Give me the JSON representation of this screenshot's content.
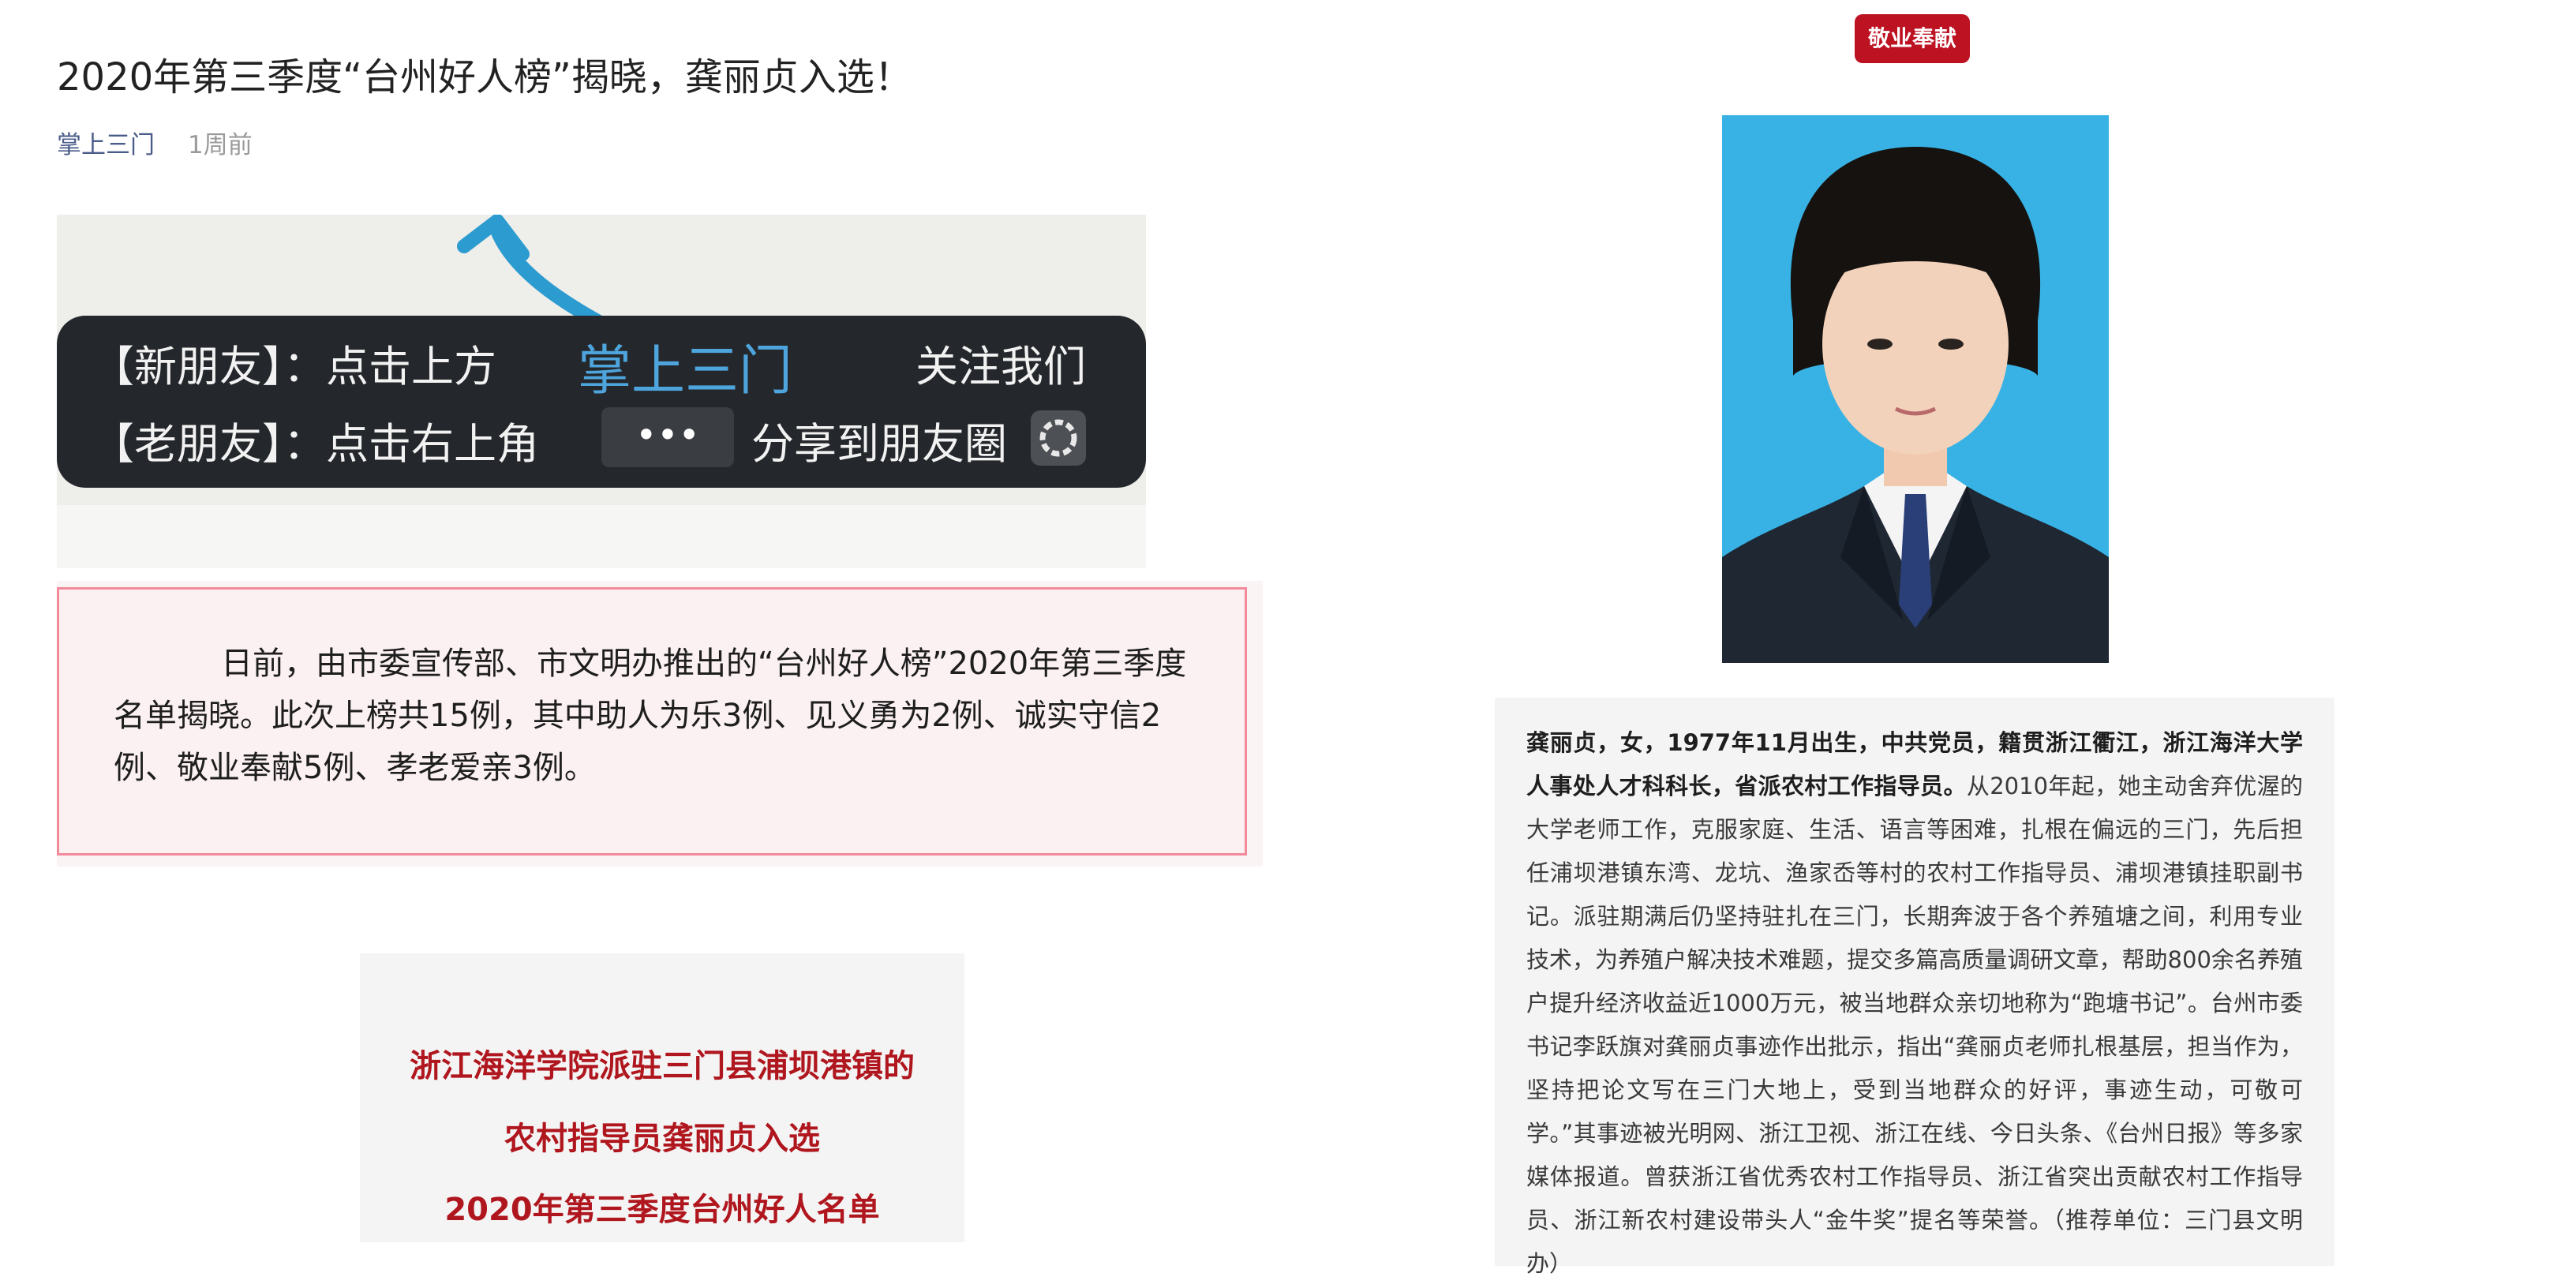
{
  "article": {
    "title": "2020年第三季度“台州好人榜”揭晓，龚丽贞入选！",
    "source": "掌上三门",
    "age": "1周前"
  },
  "banner": {
    "new_friend": "【新朋友】：点击上方",
    "account": "掌上三门",
    "follow": "关注我们",
    "old_friend": "【老朋友】：点击右上角",
    "more_glyph": "•••",
    "share": "分享到朋友圈"
  },
  "intro": "日前，由市委宣传部、市文明办推出的“台州好人榜”2020年第三季度名单揭晓。此次上榜共15例，其中助人为乐3例、见义勇为2例、诚实守信2例、敬业奉献5例、孝老爱亲3例。",
  "card": {
    "line1": "浙江海洋学院派驻三门县浦坝港镇的",
    "line2": "农村指导员龚丽贞入选",
    "line3": "2020年第三季度台州好人名单"
  },
  "category_tag": "敬业奉献",
  "bio": {
    "lead": "龚丽贞，女，1977年11月出生，中共党员，籍贯浙江衢江，浙江海洋大学人事处人才科科长，省派农村工作指导员。",
    "body": "从2010年起，她主动舍弃优渥的大学老师工作，克服家庭、生活、语言等困难，扎根在偏远的三门，先后担任浦坝港镇东湾、龙坑、渔家岙等村的农村工作指导员、浦坝港镇挂职副书记。派驻期满后仍坚持驻扎在三门，长期奔波于各个养殖塘之间，利用专业技术，为养殖户解决技术难题，提交多篇高质量调研文章，帮助800余名养殖户提升经济收益近1000万元，被当地群众亲切地称为“跑塘书记”。台州市委书记李跃旗对龚丽贞事迹作出批示，指出“龚丽贞老师扎根基层，担当作为，坚持把论文写在三门大地上，受到当地群众的好评，事迹生动，可敬可学。”其事迹被光明网、浙江卫视、浙江在线、今日头条、《台州日报》等多家媒体报道。曾获浙江省优秀农村工作指导员、浙江省突出贡献农村工作指导员、浙江新农村建设带头人“金牛奖”提名等荣誉。（推荐单位：三门县文明办）"
  },
  "colors": {
    "tag_red": "#bd1222",
    "heading_red": "#b0161e",
    "intro_border": "#f28a9a",
    "portrait_bg": "#38b2e4",
    "account_blue": "#4ea4dc"
  }
}
